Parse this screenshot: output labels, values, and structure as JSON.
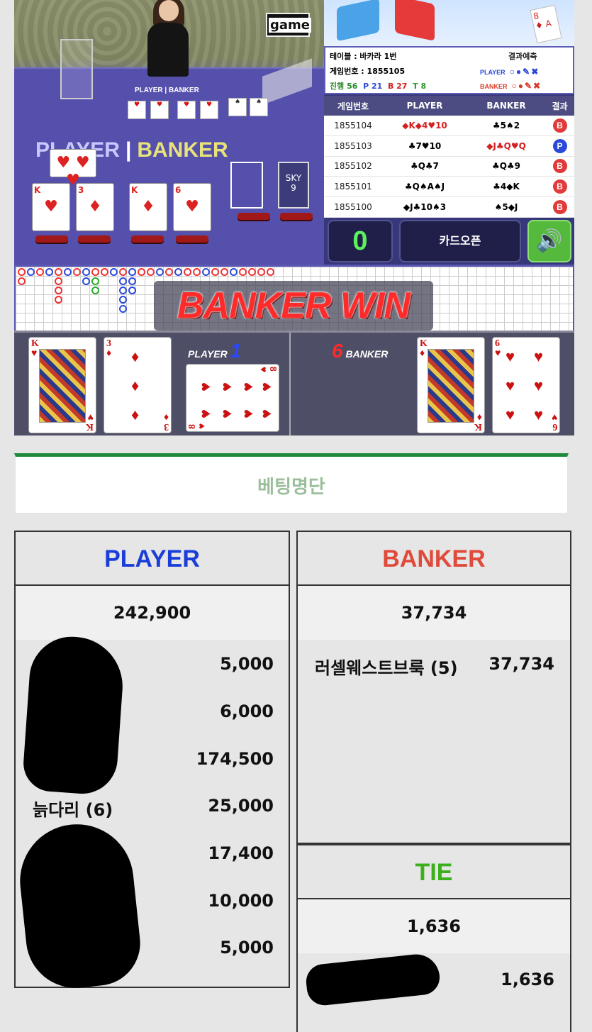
{
  "game": {
    "logo": "game",
    "felt": {
      "player": "PLAYER",
      "banker": "BANKER"
    },
    "info": {
      "table": "테이블 : 바카라 1번",
      "game_no": "게임번호 : 1855105",
      "progress_label": "진행 56",
      "p_count": "P 21",
      "b_count": "B 27",
      "t_count": "T 8",
      "prediction": "결과예측",
      "legend_player": "PLAYER",
      "legend_banker": "BANKER"
    },
    "results": {
      "headers": [
        "게임번호",
        "PLAYER",
        "BANKER",
        "결과"
      ],
      "rows": [
        {
          "no": "1855104",
          "player": "◆K◆4♥10",
          "banker": "♣5♠2",
          "result": "B"
        },
        {
          "no": "1855103",
          "player": "♣7♥10",
          "banker": "◆J♣Q♥Q",
          "result": "P"
        },
        {
          "no": "1855102",
          "player": "♣Q♣7",
          "banker": "♣Q♣9",
          "result": "B"
        },
        {
          "no": "1855101",
          "player": "♣Q♠A♠J",
          "banker": "♣4◆K",
          "result": "B"
        },
        {
          "no": "1855100",
          "player": "◆J♣10♠3",
          "banker": "♠5◆J",
          "result": "B"
        }
      ]
    },
    "counter": "0",
    "open_button": "카드오픈",
    "sound_icon": "speaker-icon",
    "win_banner": "BANKER WIN",
    "overlay": {
      "player_label": "PLAYER",
      "player_score": "1",
      "banker_label": "BANKER",
      "banker_score": "6"
    }
  },
  "betting": {
    "title": "베팅명단",
    "player": {
      "heading": "PLAYER",
      "color": "#1a3ed8",
      "total": "242,900",
      "rows": [
        {
          "name": "",
          "amount": "5,000"
        },
        {
          "name": "",
          "amount": "6,000"
        },
        {
          "name": "",
          "amount": "174,500"
        },
        {
          "name": "늙다리 (6)",
          "amount": "25,000"
        },
        {
          "name": "",
          "amount": "17,400"
        },
        {
          "name": "",
          "amount": "10,000"
        },
        {
          "name": "",
          "amount": "5,000"
        }
      ]
    },
    "banker": {
      "heading": "BANKER",
      "color": "#e04a3a",
      "total": "37,734",
      "rows": [
        {
          "name": "러셀웨스트브룩 (5)",
          "amount": "37,734"
        }
      ]
    },
    "tie": {
      "heading": "TIE",
      "color": "#3cb01c",
      "total": "1,636",
      "rows": [
        {
          "name": "",
          "amount": "1,636"
        }
      ]
    }
  }
}
